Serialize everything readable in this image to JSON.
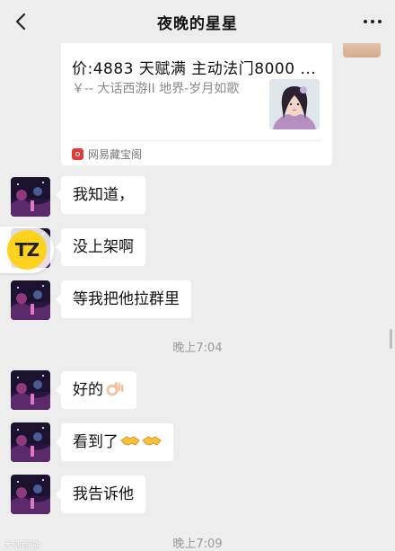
{
  "header": {
    "title": "夜晚的星星",
    "back_icon": "chevron-left-icon",
    "more_icon": "more-dots-icon"
  },
  "card": {
    "price_line": "价:4883 天赋满 主动法门8000 ...",
    "description": "￥-- 大话西游II 地界-岁月如歌",
    "source": "网易藏宝阁",
    "source_icon": "netease-cangbaoge-logo-icon"
  },
  "badge": {
    "text": "TZ"
  },
  "messages": [
    {
      "text": "我知道，"
    },
    {
      "text": "没上架啊"
    },
    {
      "text": "等我把他拉群里"
    },
    {
      "text": "好的",
      "emoji": "ok-hand-emoji"
    },
    {
      "text": "看到了",
      "emoji": "handshake-emoji"
    },
    {
      "text": "我告诉他"
    }
  ],
  "timestamps": [
    "晚上7:04",
    "晚上7:09"
  ],
  "watermark": "大话西游"
}
